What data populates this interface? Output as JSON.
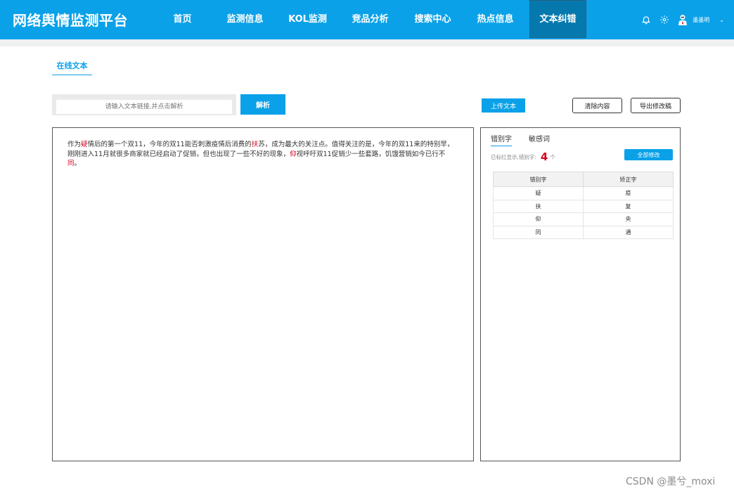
{
  "header": {
    "brand": "网络舆情监测平台",
    "nav": [
      "首页",
      "监测信息",
      "KOL监测",
      "竞品分析",
      "搜索中心",
      "热点信息",
      "文本纠错"
    ],
    "active_nav": 6,
    "user_name": "墨墨明",
    "caret": "⌄"
  },
  "tab": {
    "label": "在线文本"
  },
  "url": {
    "placeholder": "请输入文本链接,并点击解析"
  },
  "buttons": {
    "parse": "解析",
    "upload": "上传文本",
    "clear": "清除内容",
    "export": "导出修改稿",
    "fix_all": "全部修改"
  },
  "editor": {
    "segments": [
      {
        "t": "作为",
        "e": false
      },
      {
        "t": "疑",
        "e": true
      },
      {
        "t": "情后的第一个双11，今年的双11能否刺激疫情后消费的",
        "e": false
      },
      {
        "t": "扶",
        "e": true
      },
      {
        "t": "苏，成为最大的关注点。值得关注的是，今年的双11来的特别早，刚刚进入11月就很多商家就已经启动了促销，但也出现了一些不好的现象，",
        "e": false
      },
      {
        "t": "仰",
        "e": true
      },
      {
        "t": "视呼吁双11促销少一些套路，饥饿营销如今已行不",
        "e": false
      },
      {
        "t": "同",
        "e": true
      },
      {
        "t": "。",
        "e": false
      }
    ]
  },
  "panel": {
    "tabs": [
      "错别字",
      "敏感词"
    ],
    "summary_label": "已标红显示,错别字:",
    "count": "4",
    "count_unit": "个",
    "table": {
      "headers": [
        "错别字",
        "矫正字"
      ],
      "rows": [
        [
          "疑",
          "疫"
        ],
        [
          "扶",
          "复"
        ],
        [
          "仰",
          "央"
        ],
        [
          "同",
          "通"
        ]
      ]
    }
  },
  "watermark": "CSDN @墨兮_moxi",
  "colors": {
    "primary": "#0aa1e8",
    "active_nav": "#0579ad",
    "error": "#d6001c"
  }
}
